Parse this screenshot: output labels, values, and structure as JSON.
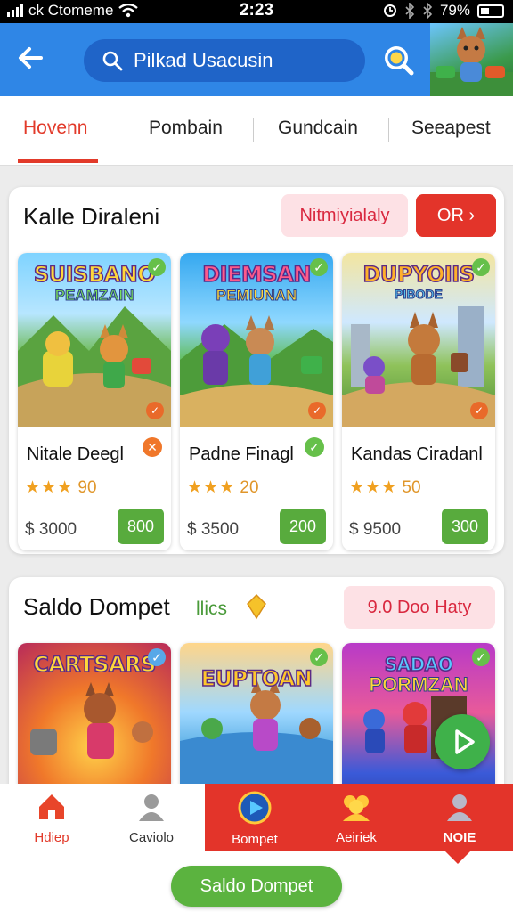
{
  "status": {
    "carrier": "ck Ctomeme",
    "time": "2:23",
    "battery": "79%"
  },
  "header": {
    "search_text": "Pilkad Usacusin"
  },
  "tabs": [
    {
      "label": "Hovenn",
      "active": true
    },
    {
      "label": "Pombain",
      "active": false
    },
    {
      "label": "Gundcain",
      "active": false
    },
    {
      "label": "Seeapest",
      "active": false
    }
  ],
  "section1": {
    "title": "Kalle Diraleni",
    "pill_label": "Nitmiyialaly",
    "button_label": "OR ›",
    "games": [
      {
        "art_title": "SUISBANO",
        "art_sub": "PEAMZAIN",
        "name": "Nitale Deegl",
        "stars": "★★★",
        "rating": "90",
        "price": "$ 3000",
        "buy": "800",
        "badge_color": "#f0772a"
      },
      {
        "art_title": "DIEMSAN",
        "art_sub": "PEMIUNAN",
        "name": "Padne Finagl",
        "stars": "★★★",
        "rating": "20",
        "price": "$ 3500",
        "buy": "200",
        "badge_color": "#66c04a"
      },
      {
        "art_title": "DUPYOIIS",
        "art_sub": "PIBODE",
        "name": "Kandas Ciradanl",
        "stars": "★★★",
        "rating": "50",
        "price": "$ 9500",
        "buy": "300",
        "badge_color": ""
      }
    ]
  },
  "section2": {
    "title": "Saldo Dompet",
    "subtitle": "llics",
    "pill_label": "9.0  Doo Haty",
    "games": [
      {
        "art_title": "CARTSARS",
        "art_sub": ""
      },
      {
        "art_title": "EUPTOAN",
        "art_sub": ""
      },
      {
        "art_title": "SADAO",
        "art_sub": "PORMZAN"
      }
    ]
  },
  "bottom_nav": {
    "items": [
      {
        "label": "Hdiep",
        "icon": "home-icon"
      },
      {
        "label": "Caviolo",
        "icon": "user-icon"
      },
      {
        "label": "Bompet",
        "icon": "play-disc-icon"
      },
      {
        "label": "Aeiriek",
        "icon": "group-icon"
      },
      {
        "label": "NOIE",
        "icon": "profile-icon"
      }
    ],
    "cta_label": "Saldo Dompet"
  },
  "colors": {
    "header_blue": "#2f86e6",
    "accent_red": "#e3342a",
    "buy_green": "#58ab3d",
    "pill_pink": "#fde1e5"
  }
}
